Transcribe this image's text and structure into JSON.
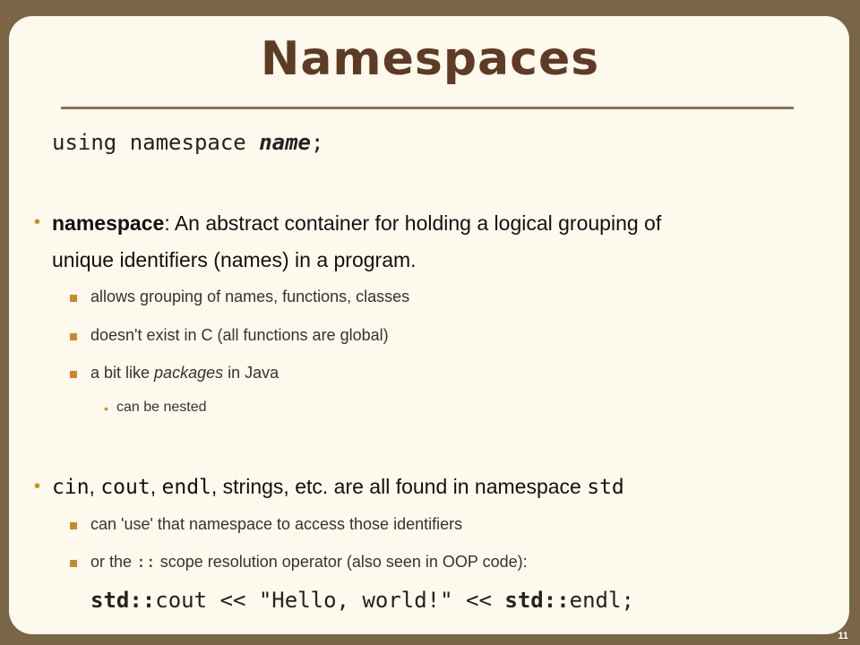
{
  "title": "Namespaces",
  "syntax": {
    "kw1": "using",
    "kw2": "namespace",
    "arg": "name",
    "semi": ";"
  },
  "bullet1": {
    "term": "namespace",
    "rest_line1": ": An abstract container for holding a logical grouping of",
    "line2": "unique identifiers (names) in a program.",
    "sub1": "allows grouping of names, functions, classes",
    "sub2": "doesn't exist in C (all functions are global)",
    "sub3_pre": "a bit like ",
    "sub3_em": "packages",
    "sub3_post": " in Java",
    "subsub1": "can be nested"
  },
  "bullet2": {
    "c1": "cin",
    "s1": ", ",
    "c2": "cout",
    "s2": ", ",
    "c3": "endl",
    "rest": ", strings, etc. are all found in namespace ",
    "c4": "std",
    "sub1": "can 'use' that namespace to access those identifiers",
    "sub2_pre": "or the ",
    "sub2_code": "::",
    "sub2_post": " scope resolution operator (also seen in OOP code):",
    "code_std1": "std::",
    "code_mid": "cout << \"Hello, world!\" << ",
    "code_std2": "std::",
    "code_end": "endl;"
  },
  "slide_number": "11"
}
